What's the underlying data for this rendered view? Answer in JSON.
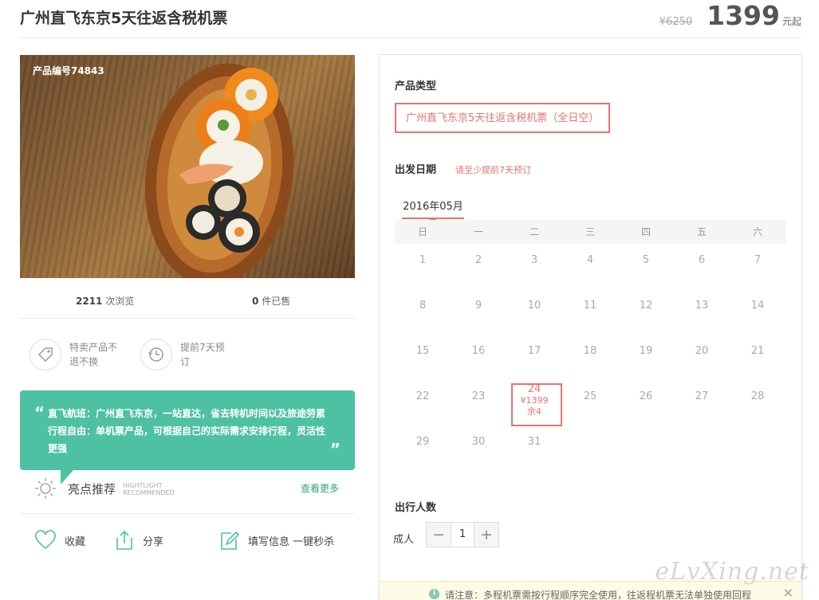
{
  "header": {
    "title": "广州直飞东京5天往返含税机票",
    "orig_price": "¥6250",
    "price": "1399",
    "price_unit": "元起"
  },
  "photo": {
    "product_code": "产品编号74843"
  },
  "stats": {
    "views_count": "2211",
    "views_label": "次浏览",
    "sold_count": "0",
    "sold_label": "件已售"
  },
  "features": [
    {
      "icon": "tag-icon",
      "text": "特卖产品不退不换"
    },
    {
      "icon": "clock-history-icon",
      "text": "提前7天预订"
    }
  ],
  "quote": {
    "open": "“",
    "close": "”",
    "text": "直飞航班：广州直飞东京，一站直达，省去转机时间以及旅途劳累 行程自由：单机票产品，可根据自己的实际需求安排行程，灵活性更强"
  },
  "highlight": {
    "title": "亮点推荐",
    "en1": "HIGHTLIGHT",
    "en2": "RECOMMENDED",
    "more": "查看更多"
  },
  "actions": {
    "favorite": "收藏",
    "share": "分享",
    "fill_info": "填写信息 一键秒杀"
  },
  "booking": {
    "type_label": "产品类型",
    "type_option": "广州直飞东京5天往返含税机票（全日空）",
    "date_label": "出发日期",
    "date_note": "请至少提前7天预订",
    "month": "2016年05月",
    "weekdays": [
      "日",
      "一",
      "二",
      "三",
      "四",
      "五",
      "六"
    ],
    "weeks": [
      [
        "1",
        "2",
        "3",
        "4",
        "5",
        "6",
        "7"
      ],
      [
        "8",
        "9",
        "10",
        "11",
        "12",
        "13",
        "14"
      ],
      [
        "15",
        "16",
        "17",
        "18",
        "19",
        "20",
        "21"
      ],
      [
        "22",
        "23",
        "24",
        "25",
        "26",
        "27",
        "28"
      ],
      [
        "29",
        "30",
        "31",
        "",
        "",
        "",
        ""
      ]
    ],
    "selected_day": {
      "day": "24",
      "price": "¥1399",
      "remain": "余4"
    },
    "people_label": "出行人数",
    "adult_label": "成人",
    "adult_count": "1",
    "minus": "−",
    "plus": "+"
  },
  "notice": {
    "icon": "i",
    "text": "请注意：多程机票需按行程顺序完全使用，往返程机票无法单独使用回程",
    "close": "×"
  },
  "watermark": "eLvXing.net",
  "colors": {
    "accent": "#e8736c",
    "teal": "#4dc1a2",
    "link_green": "#2fa67f"
  }
}
